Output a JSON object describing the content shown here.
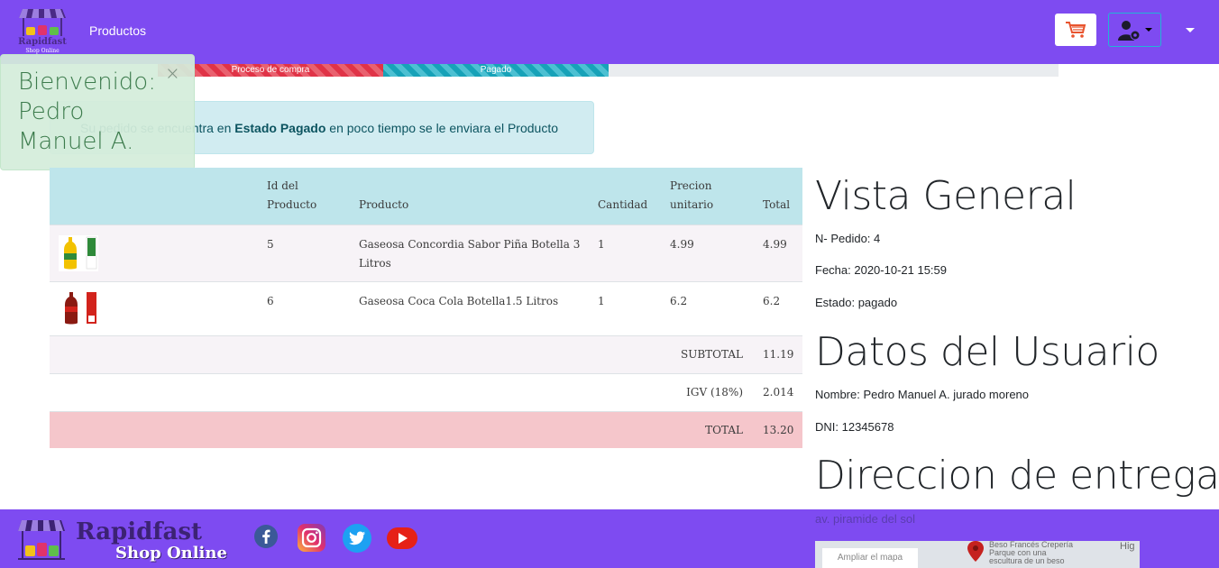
{
  "navbar": {
    "brand_line1": "Rapidfast",
    "brand_line2": "Shop Online",
    "link_products": "Productos"
  },
  "progress": {
    "steps": [
      {
        "label": "Proceso de compra",
        "fraction": 0.25,
        "color": "#e03347"
      },
      {
        "label": "Pagado",
        "fraction": 0.25,
        "color": "#17a2b8"
      }
    ]
  },
  "welcome": {
    "line1": "Bienvenido:",
    "line2": "Pedro",
    "line3": "Manuel A.",
    "close": "×"
  },
  "alert": {
    "prefix": "Su pedido se encuentra en ",
    "bold": "Estado Pagado",
    "suffix": " en poco tiempo se le enviara el Producto"
  },
  "table": {
    "headers": {
      "id_line1": "Id del",
      "id_line2": "Producto",
      "product": "Producto",
      "qty": "Cantidad",
      "price_line1": "Precion",
      "price_line2": "unitario",
      "total": "Total"
    },
    "rows": [
      {
        "id": "5",
        "product_line1": "Gaseosa Concordia Sabor Piña Botella 3",
        "product_line2": "Litros",
        "qty": "1",
        "price": "4.99",
        "total": "4.99",
        "image": "bottle-icon"
      },
      {
        "id": "6",
        "product_line1": "Gaseosa Coca Cola Botella1.5 Litros",
        "product_line2": "",
        "qty": "1",
        "price": "6.2",
        "total": "6.2",
        "image": "bottle-icon"
      }
    ],
    "subtotal_label": "SUBTOTAL",
    "subtotal_value": "11.19",
    "igv_label": "IGV (18%)",
    "igv_value": "2.014",
    "total_label": "TOTAL",
    "total_value": "13.20"
  },
  "summary": {
    "title": "Vista General",
    "order": "N- Pedido: 4",
    "date": "Fecha: 2020-10-21 15:59",
    "status": "Estado: pagado"
  },
  "user": {
    "title": "Datos del Usuario",
    "name": "Nombre: Pedro Manuel A. jurado moreno",
    "dni": "DNI: 12345678"
  },
  "delivery": {
    "title": "Direccion de entrega",
    "address": "av. piramide del sol",
    "map_button": "Ampliar el mapa",
    "map_place_line1": "Beso Francés Crepería",
    "map_place_line2": "Parque con una",
    "map_place_line3": "escultura de un beso",
    "map_label_right": "Hig"
  },
  "footer": {
    "brand_line1": "Rapidfast",
    "brand_line2": "Shop Online",
    "social": [
      "facebook-icon",
      "instagram-icon",
      "twitter-icon",
      "youtube-icon"
    ]
  },
  "colors": {
    "primary": "#7e4bf1",
    "table_header": "#bee5eb",
    "total_row": "#f5c6cb"
  }
}
